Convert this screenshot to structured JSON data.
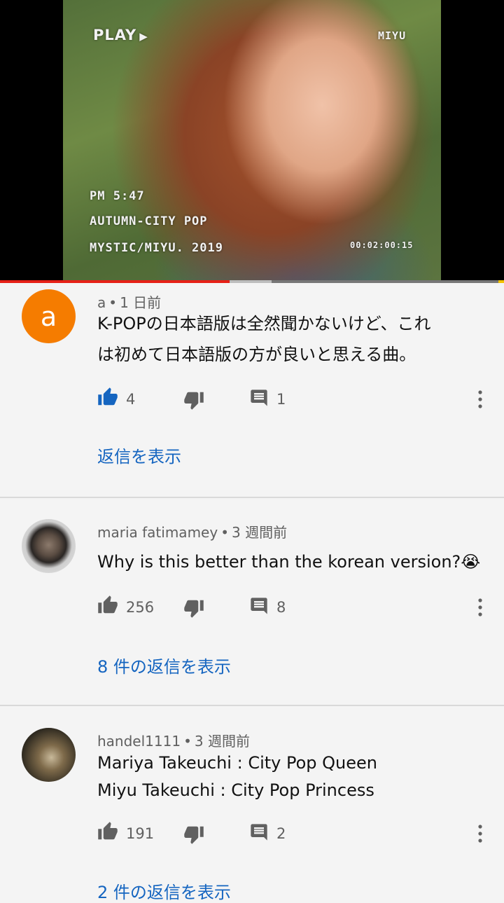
{
  "video": {
    "play_label": "PLAY",
    "channel_tag": "MIYU",
    "osd_time": "PM 5:47",
    "osd_title": "AUTUMN-CITY POP",
    "osd_credit": "MYSTIC/MIYU. 2019",
    "timecode": "00:02:00:15",
    "progress_fraction": 0.455,
    "colors": {
      "progress_played": "#e62117"
    }
  },
  "comments": [
    {
      "avatar_letter": "a",
      "author": "a",
      "time": "1 日前",
      "text_lines": [
        "K-POPの日本語版は全然聞かないけど、これ",
        "は初めて日本語版の方が良いと思える曲。"
      ],
      "likes": "4",
      "replies": "1",
      "liked": true,
      "show_replies": "返信を表示"
    },
    {
      "author": "maria fatimamey",
      "time": "3 週間前",
      "text_lines": [
        "Why is this better than the korean version?😭"
      ],
      "likes": "256",
      "replies": "8",
      "liked": false,
      "show_replies": "8 件の返信を表示"
    },
    {
      "author": "handel1111",
      "time": "3 週間前",
      "text_lines": [
        "Mariya Takeuchi : City Pop Queen",
        "Miyu Takeuchi : City Pop Princess"
      ],
      "likes": "191",
      "replies": "2",
      "liked": false,
      "show_replies": "2 件の返信を表示"
    }
  ],
  "colors": {
    "link": "#1565c0",
    "like_active": "#1565c0",
    "icon": "#606060",
    "avatar_a": "#f57c00"
  },
  "icons": [
    "thumb-up-icon",
    "thumb-down-icon",
    "reply-icon",
    "more-vert-icon"
  ]
}
